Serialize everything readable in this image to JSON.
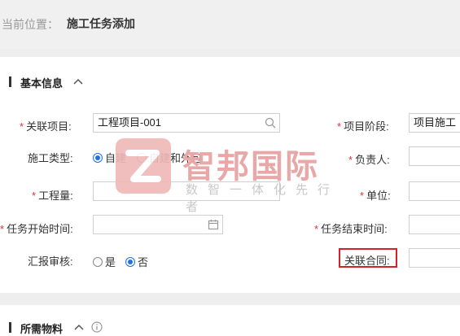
{
  "breadcrumb": {
    "label": "当前位置：",
    "current": "施工任务添加"
  },
  "section_basic": {
    "title": "基本信息"
  },
  "section_materials": {
    "title": "所需物料"
  },
  "fields": {
    "project": {
      "label": "关联项目:",
      "value": "工程项目-001",
      "required": true
    },
    "stage": {
      "label": "项目阶段:",
      "value": "项目施工",
      "required": true
    },
    "type": {
      "label": "施工类型:",
      "options": [
        "自建",
        "自建和外包"
      ],
      "selected": "自建"
    },
    "owner": {
      "label": "负责人:",
      "value": "",
      "required": true
    },
    "quantity": {
      "label": "工程量:",
      "value": "",
      "required": true
    },
    "unit": {
      "label": "单位:",
      "value": "",
      "required": true
    },
    "start": {
      "label": "任务开始时间:",
      "value": "",
      "required": true
    },
    "end": {
      "label": "任务结束时间:",
      "value": "",
      "required": true
    },
    "report": {
      "label": "汇报审核:",
      "options": [
        "是",
        "否"
      ],
      "selected": "否"
    },
    "contract": {
      "label": "关联合同:",
      "value": ""
    }
  },
  "watermark": {
    "title": "智邦国际",
    "subtitle": "数智一体化先行者"
  },
  "colors": {
    "accent": "#1f6fe5",
    "required": "#e0303a",
    "highlight": "#d8202a"
  }
}
